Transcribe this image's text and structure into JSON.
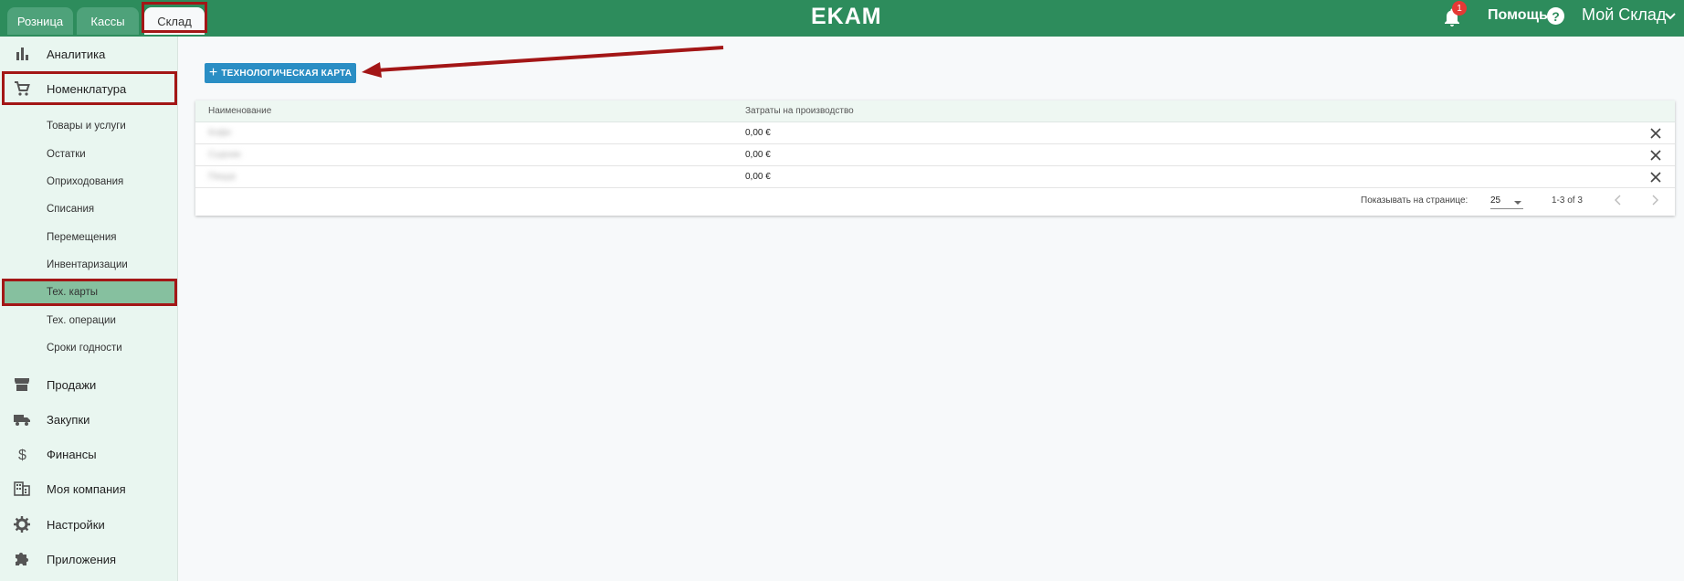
{
  "header": {
    "tabs": [
      {
        "label": "Розница",
        "active": false
      },
      {
        "label": "Кассы",
        "active": false
      },
      {
        "label": "Склад",
        "active": true
      }
    ],
    "logo": "EKAM",
    "notifications_count": "1",
    "help_label": "Помощь",
    "help_icon_glyph": "?",
    "account_label": "Мой Склад",
    "brand_color": "#2d8c5c"
  },
  "sidebar": {
    "items": [
      {
        "label": "Аналитика",
        "icon": "bar-chart-icon"
      },
      {
        "label": "Номенклатура",
        "icon": "cart-icon"
      },
      {
        "label": "Продажи",
        "icon": "store-icon"
      },
      {
        "label": "Закупки",
        "icon": "truck-icon"
      },
      {
        "label": "Финансы",
        "icon": "dollar-icon"
      },
      {
        "label": "Моя компания",
        "icon": "building-icon"
      },
      {
        "label": "Настройки",
        "icon": "gear-icon"
      },
      {
        "label": "Приложения",
        "icon": "puzzle-icon"
      }
    ],
    "subitems": [
      {
        "label": "Товары и услуги"
      },
      {
        "label": "Остатки"
      },
      {
        "label": "Оприходования"
      },
      {
        "label": "Списания"
      },
      {
        "label": "Перемещения"
      },
      {
        "label": "Инвентаризации"
      },
      {
        "label": "Тех. карты",
        "selected": true
      },
      {
        "label": "Тех. операции"
      },
      {
        "label": "Сроки годности"
      }
    ]
  },
  "main": {
    "add_button": {
      "label": "ТЕХНОЛОГИЧЕСКАЯ КАРТА",
      "icon": "plus-icon",
      "color": "#2a8ec4"
    },
    "table": {
      "columns": [
        "Наименование",
        "Затраты на производство"
      ],
      "rows": [
        {
          "name": "Кофе",
          "cost": "0,00 €"
        },
        {
          "name": "Сырник",
          "cost": "0,00 €"
        },
        {
          "name": "Пицца",
          "cost": "0,00 €"
        }
      ],
      "per_page_label": "Показывать на странице:",
      "per_page_value": "25",
      "range": "1-3 of 3"
    }
  },
  "annotation_color": "#a31616"
}
